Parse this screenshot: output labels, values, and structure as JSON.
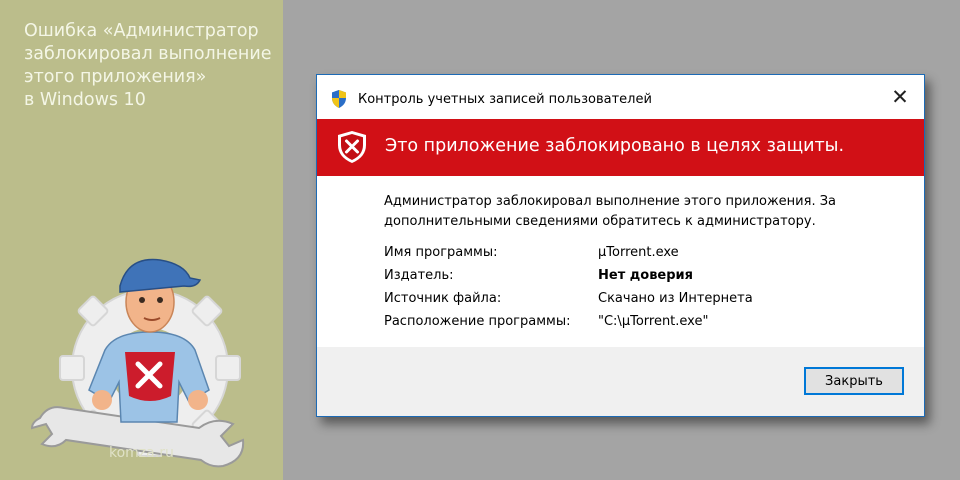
{
  "article": {
    "title_lines": [
      "Ошибка «Администратор",
      "заблокировал выполнение",
      "этого приложения»",
      "в Windows 10"
    ],
    "site": "komza.ru"
  },
  "dialog": {
    "title": "Контроль учетных записей пользователей",
    "close_glyph": "✕",
    "banner_text": "Это приложение заблокировано в целях защиты.",
    "message": "Администратор заблокировал выполнение этого приложения. За дополнительными сведениями обратитесь к администратору.",
    "details": [
      {
        "label": "Имя программы:",
        "value": "µTorrent.exe"
      },
      {
        "label": "Издатель:",
        "value": "Нет доверия"
      },
      {
        "label": "Источник файла:",
        "value": "Скачано из Интернета"
      },
      {
        "label": "Расположение программы:",
        "value": "\"C:\\µTorrent.exe\""
      }
    ],
    "close_button": "Закрыть"
  },
  "colors": {
    "banner": "#d11016",
    "left_panel": "#bbbd8b",
    "background": "#a4a4a4",
    "button_border": "#0078d7"
  },
  "icons": {
    "titlebar": "uac-shield-icon",
    "banner": "shield-x-icon",
    "mascot": "mechanic-mascot-icon"
  }
}
